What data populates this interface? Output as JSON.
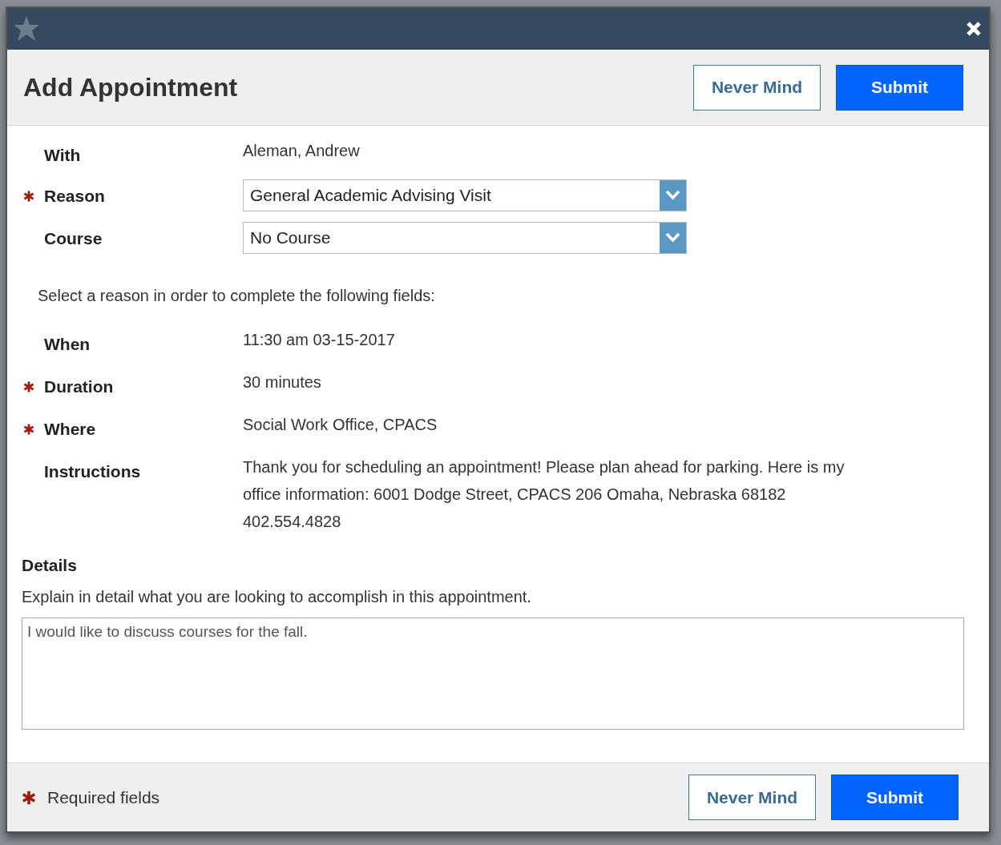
{
  "dialog": {
    "title": "Add Appointment",
    "header_buttons": [
      {
        "label": "Never Mind",
        "kind": "secondary"
      },
      {
        "label": "Submit",
        "kind": "primary"
      }
    ],
    "fields": [
      {
        "kind": "text",
        "label": "With",
        "required": false,
        "value": "Aleman, Andrew"
      },
      {
        "kind": "select",
        "label": "Reason",
        "required": true,
        "value": "General Academic Advising Visit"
      },
      {
        "kind": "select",
        "label": "Course",
        "required": false,
        "value": "No Course"
      },
      {
        "kind": "note",
        "value": "Select a reason in order to complete the following fields:"
      },
      {
        "kind": "text",
        "label": "When",
        "required": false,
        "value": "11:30 am 03-15-2017"
      },
      {
        "kind": "text",
        "label": "Duration",
        "required": true,
        "value": "30 minutes"
      },
      {
        "kind": "text",
        "label": "Where",
        "required": true,
        "value": "Social Work Office, CPACS"
      },
      {
        "kind": "text",
        "label": "Instructions",
        "required": false,
        "value": "Thank you for scheduling an appointment! Please plan ahead for parking. Here is my office information: 6001 Dodge Street, CPACS 206 Omaha, Nebraska 68182 402.554.4828"
      }
    ],
    "details": {
      "title": "Details",
      "description": "Explain in detail what you are looking to accomplish in this appointment.",
      "value": "I would like to discuss courses for the fall."
    },
    "footer": {
      "legend": "Required fields",
      "buttons": [
        {
          "label": "Never Mind",
          "kind": "secondary"
        },
        {
          "label": "Submit",
          "kind": "primary"
        }
      ]
    }
  }
}
